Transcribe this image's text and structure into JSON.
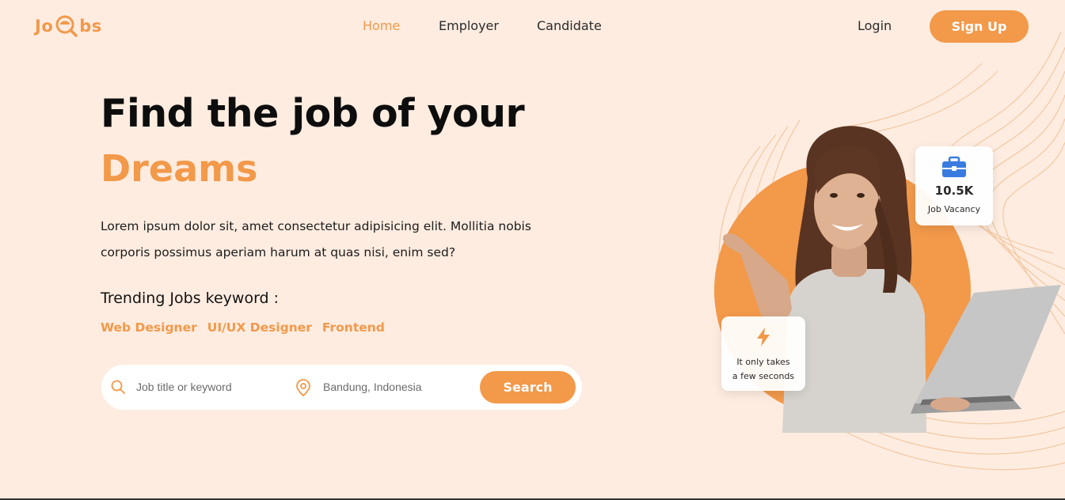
{
  "brand": {
    "logo_left": "Jo",
    "logo_right": "bs"
  },
  "nav": {
    "home": "Home",
    "employer": "Employer",
    "candidate": "Candidate",
    "login": "Login",
    "signup": "Sign Up"
  },
  "hero": {
    "title": "Find the job of your",
    "accent": "Dreams",
    "description": "Lorem ipsum dolor sit, amet consectetur adipisicing elit. Mollitia nobis corporis possimus aperiam harum at quas nisi, enim sed?",
    "trending_title": "Trending Jobs keyword :",
    "trending": [
      "Web Designer",
      "UI/UX Designer",
      "Frontend"
    ]
  },
  "search": {
    "job_placeholder": "Job title or keyword",
    "location_placeholder": "Bandung, Indonesia",
    "button": "Search"
  },
  "cards": {
    "vacancy_count": "10.5K",
    "vacancy_label": "Job Vacancy",
    "speed_line1": "It only takes",
    "speed_line2": "a few seconds"
  },
  "colors": {
    "accent": "#f2994a",
    "background": "#feece0",
    "briefcase": "#3a7be0"
  },
  "icons": [
    "magnifier-icon",
    "search-icon",
    "location-pin-icon",
    "briefcase-icon",
    "lightning-icon"
  ]
}
